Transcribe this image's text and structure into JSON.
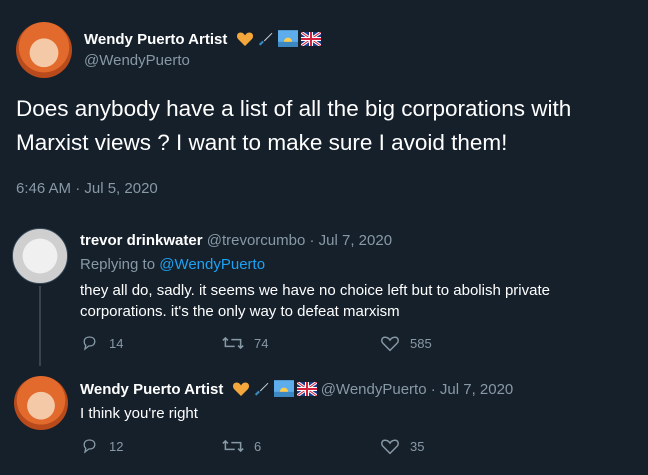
{
  "main_tweet": {
    "author_name": "Wendy Puerto Artist",
    "author_handle": "@WendyPuerto",
    "badges": [
      "orange-heart-icon",
      "paintbrush-icon",
      "sunrise-icon",
      "uk-flag-icon"
    ],
    "text": "Does anybody have a list of all the big corporations with Marxist views ? I want to make sure I avoid them!",
    "timestamp": "6:46 AM · Jul 5, 2020"
  },
  "reply1": {
    "author_name": "trevor drinkwater",
    "author_handle": "@trevorcumbo",
    "separator": "·",
    "date": "Jul 7, 2020",
    "replying_prefix": "Replying to",
    "replying_handle": "@WendyPuerto",
    "text": "they all do, sadly. it seems we have no choice left but to abolish private corporations. it's the only way to defeat marxism",
    "replies": "14",
    "retweets": "74",
    "likes": "585"
  },
  "reply2": {
    "author_name": "Wendy Puerto Artist",
    "author_handle": "@WendyPuerto",
    "separator": "·",
    "date": "Jul 7, 2020",
    "text": "I think you're right",
    "replies": "12",
    "retweets": "6",
    "likes": "35"
  },
  "colors": {
    "background": "#15202b",
    "secondary_text": "#8899a6",
    "link": "#1da1f2",
    "heart_badge": "#f4a73b"
  }
}
